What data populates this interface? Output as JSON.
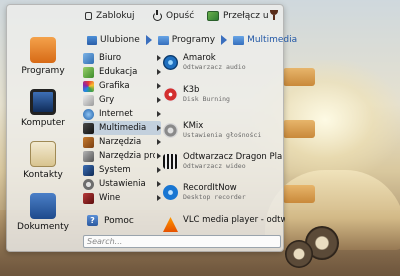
{
  "top": {
    "lock_label": "Zablokuj",
    "logout_label": "Opuść",
    "switch_label": "Przełącz u"
  },
  "breadcrumb": [
    {
      "label": "Ulubione"
    },
    {
      "label": "Programy"
    },
    {
      "label": "Multimedia"
    }
  ],
  "favorites": [
    {
      "label": "Programy",
      "icon": "applications-folder-icon"
    },
    {
      "label": "Komputer",
      "icon": "computer-icon"
    },
    {
      "label": "Kontakty",
      "icon": "contacts-icon"
    },
    {
      "label": "Dokumenty",
      "icon": "documents-icon"
    }
  ],
  "categories": [
    {
      "label": "Biuro"
    },
    {
      "label": "Edukacja"
    },
    {
      "label": "Grafika"
    },
    {
      "label": "Gry"
    },
    {
      "label": "Internet"
    },
    {
      "label": "Multimedia"
    },
    {
      "label": "Narzędzia"
    },
    {
      "label": "Narzędzia prog"
    },
    {
      "label": "System"
    },
    {
      "label": "Ustawienia"
    },
    {
      "label": "Wine"
    }
  ],
  "apps": [
    {
      "name": "Amarok",
      "desc": "Odtwarzacz audio"
    },
    {
      "name": "K3b",
      "desc": "Disk Burning"
    },
    {
      "name": "KMix",
      "desc": "Ustawienia głośności"
    },
    {
      "name": "Odtwarzacz Dragon Pla",
      "desc": "Odtwarzacz wideo"
    },
    {
      "name": "RecordItNow",
      "desc": "Desktop recorder"
    },
    {
      "name": "VLC media player - odtw",
      "desc": ""
    }
  ],
  "help_label": "Pomoc",
  "search_placeholder": "Search...",
  "colors": {
    "accent": "#2358a6",
    "selection": "#a8c2e2"
  }
}
